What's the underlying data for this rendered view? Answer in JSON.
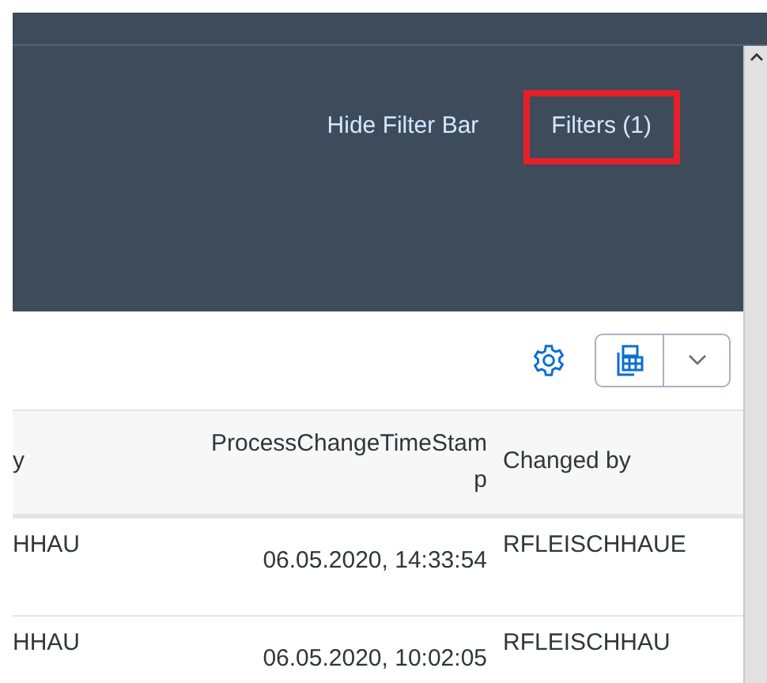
{
  "filter_bar": {
    "actions": [
      {
        "label": "Hide Filter Bar",
        "highlighted": false
      },
      {
        "label": "Filters (1)",
        "highlighted": true
      }
    ]
  },
  "table": {
    "columns": [
      "y",
      "ProcessChangeTimeStamp",
      "Changed by"
    ],
    "rows": [
      [
        "HHAU",
        "06.05.2020, 14:33:54",
        "RFLEISCHHAUE"
      ],
      [
        "HHAU",
        "06.05.2020, 10:02:05",
        "RFLEISCHHAU"
      ]
    ]
  }
}
